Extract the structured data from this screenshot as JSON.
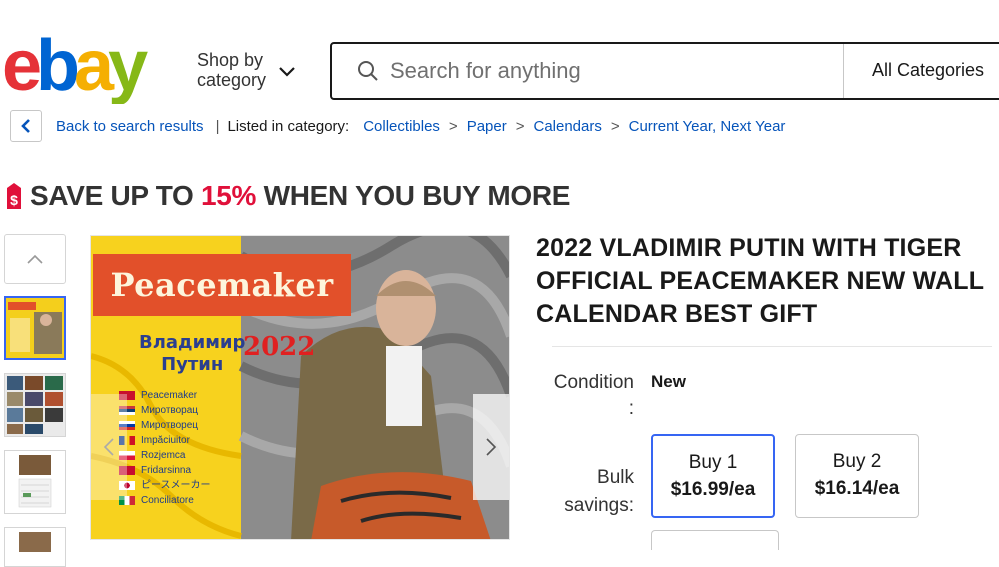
{
  "header": {
    "logo_text": "ebay",
    "shop_by_line1": "Shop by",
    "shop_by_line2": "category",
    "search_placeholder": "Search for anything",
    "categories_label": "All Categories"
  },
  "breadcrumb": {
    "back_label": "Back to search results",
    "listed_label": "Listed in category:",
    "path": [
      "Collectibles",
      "Paper",
      "Calendars",
      "Current Year, Next Year"
    ],
    "separator": ">"
  },
  "promo": {
    "prefix": "SAVE UP TO ",
    "percent": "15%",
    "suffix": " WHEN YOU BUY MORE",
    "accent_color": "#e0103a"
  },
  "image": {
    "banner_text": "Peacemaker",
    "name_line1": "Владимир",
    "name_line2": "Путин",
    "year": "2022",
    "languages": [
      "Peacemaker",
      "Миротворац",
      "Миротворец",
      "Impăciuitor",
      "Rozjemca",
      "Fridarsinna",
      "ピースメーカー",
      "Conciliatore"
    ]
  },
  "product": {
    "title": "2022 VLADIMIR PUTIN WITH TIGER OFFICIAL PEACEMAKER NEW WALL CALENDAR BEST GIFT",
    "condition_label": "Condition",
    "condition_colon": ":",
    "condition_value": "New",
    "bulk_label_1": "Bulk",
    "bulk_label_2": "savings:",
    "bulk_options": [
      {
        "qty": "Buy 1",
        "price": "$16.99/ea"
      },
      {
        "qty": "Buy 2",
        "price": "$16.14/ea"
      }
    ]
  },
  "colors": {
    "link": "#0654ba",
    "selected_border": "#3665f3",
    "logo_e": "#e53238",
    "logo_b": "#0064d2",
    "logo_a": "#f5af02",
    "logo_y": "#86b817"
  }
}
